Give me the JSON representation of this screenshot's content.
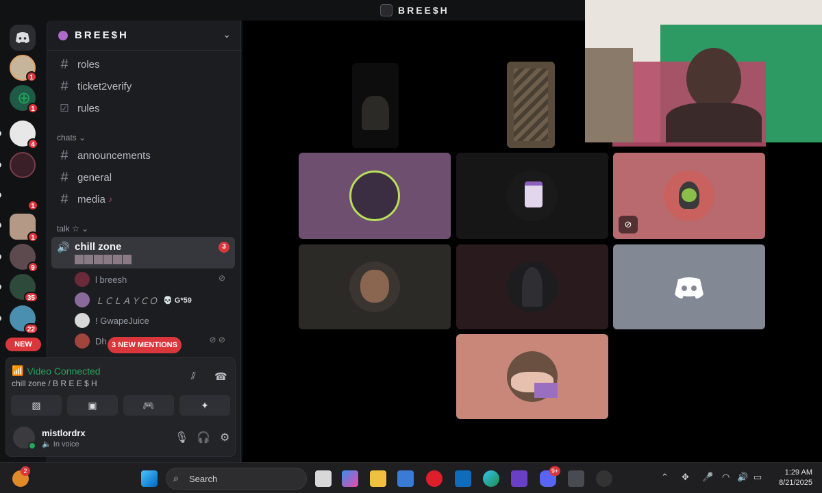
{
  "window": {
    "title": "BREE$H"
  },
  "server_rail": {
    "badges": [
      "1",
      "1",
      "4",
      "1",
      "1",
      "9",
      "35",
      "22"
    ],
    "new_label": "NEW"
  },
  "guild": {
    "name": "BREE$H"
  },
  "channels_top": [
    {
      "label": "roles"
    },
    {
      "label": "ticket2verify"
    },
    {
      "label": "rules"
    }
  ],
  "category_chats": "chats",
  "channels_chats": [
    {
      "label": "announcements"
    },
    {
      "label": "general"
    },
    {
      "label": "media"
    }
  ],
  "category_talk": "talk ☆",
  "voice_channel": {
    "label": "chill zone",
    "badge": "3"
  },
  "voice_users": [
    {
      "name": "l breesh",
      "tag": ""
    },
    {
      "name": "ＬＣＬＡＹＣＯ",
      "tag": "💀 G*59"
    },
    {
      "name": "! GwapeJuice",
      "tag": ""
    },
    {
      "name": "Dh",
      "tag": ""
    }
  ],
  "mentions_pill": "3 NEW MENTIONS",
  "voice_panel": {
    "status": "Video Connected",
    "location": "chill zone / B R E E $ H"
  },
  "user": {
    "name": "mistlordrx",
    "status": "In voice"
  },
  "taskbar": {
    "search_label": "Search",
    "time": "1:29 AM",
    "date": "8/21/2025",
    "discord_badge": "9+",
    "weather_badge": "2"
  },
  "colors": {
    "tile_purple": "#6e4f70",
    "tile_dark": "#161616",
    "tile_rose": "#b86a6f",
    "tile_brown": "#2c2a26",
    "tile_plum": "#281a1d",
    "tile_gray": "#828894",
    "tile_peach": "#c9877a",
    "connected_green": "#23a55a",
    "badge_red": "#da373c"
  }
}
